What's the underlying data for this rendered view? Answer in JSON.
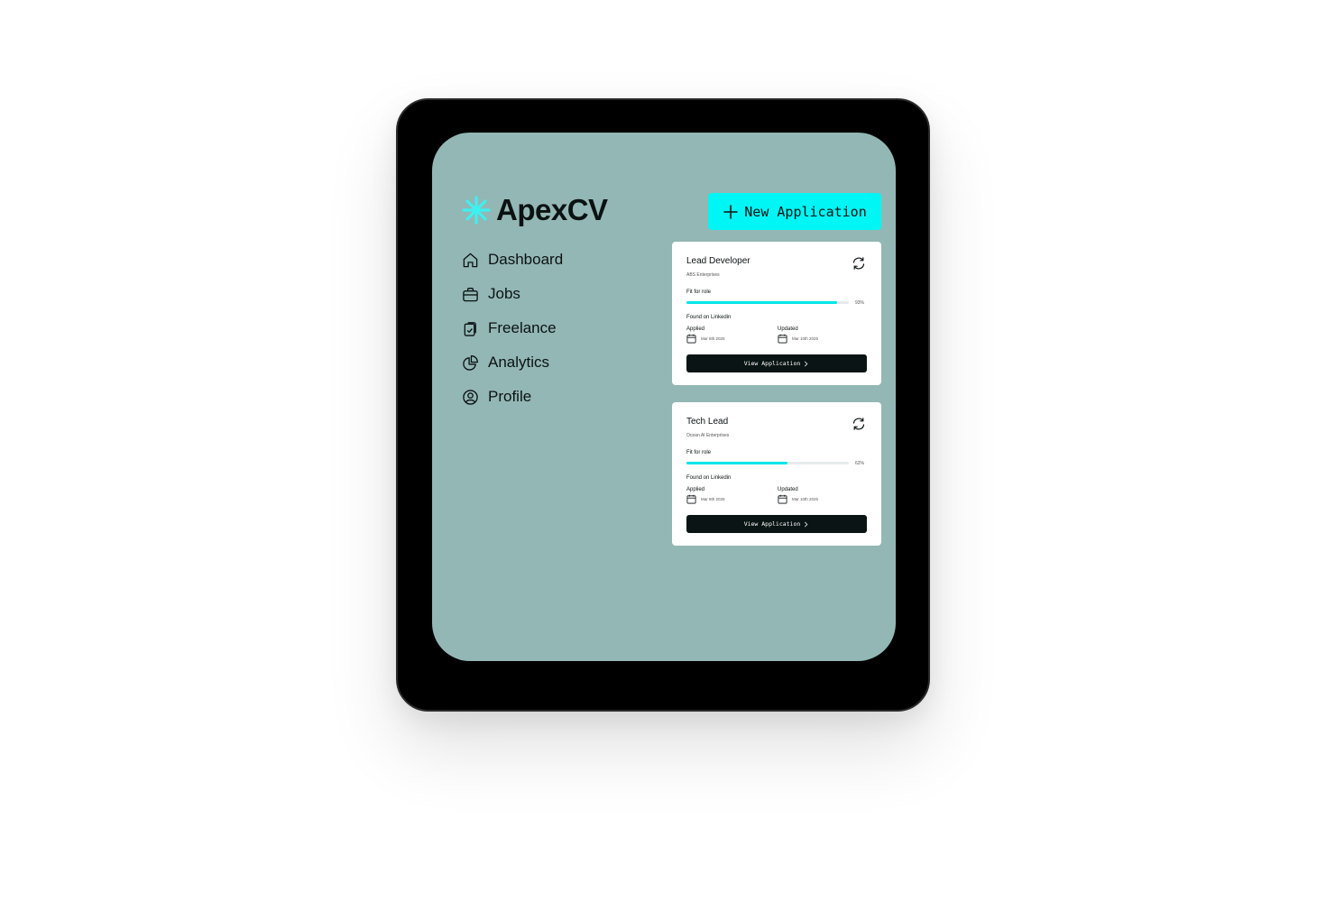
{
  "app": {
    "name": "ApexCV"
  },
  "colors": {
    "accent": "#00f5f5",
    "screen_bg": "#93b7b5",
    "dark": "#0b1414",
    "progress": "#00e5e8"
  },
  "sidebar": {
    "items": [
      {
        "label": "Dashboard",
        "icon": "home-icon"
      },
      {
        "label": "Jobs",
        "icon": "briefcase-icon"
      },
      {
        "label": "Freelance",
        "icon": "clipboard-icon"
      },
      {
        "label": "Analytics",
        "icon": "pie-chart-icon"
      },
      {
        "label": "Profile",
        "icon": "user-circle-icon"
      }
    ]
  },
  "header": {
    "new_application_label": "New Application"
  },
  "applications": [
    {
      "title": "Lead Developer",
      "company": "ABS Enterprises",
      "fit_label": "Fit for role",
      "fit_percent": 93,
      "fit_text": "93%",
      "source": "Found on Linkedin",
      "applied_label": "Applied",
      "applied_date": "Mar 8th 2025",
      "updated_label": "Updated",
      "updated_date": "Mar 10th 2025",
      "button_label": "View Application"
    },
    {
      "title": "Tech Lead",
      "company": "Ocean AI Enterprises",
      "fit_label": "Fit for role",
      "fit_percent": 62,
      "fit_text": "62%",
      "source": "Found on Linkedin",
      "applied_label": "Applied",
      "applied_date": "Mar 8th 2025",
      "updated_label": "Updated",
      "updated_date": "Mar 10th 2025",
      "button_label": "View Application"
    }
  ]
}
